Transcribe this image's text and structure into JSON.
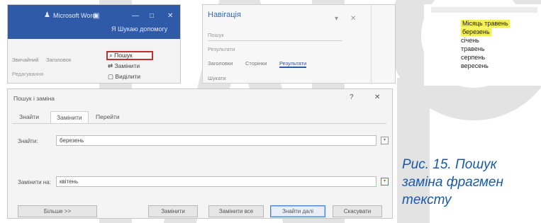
{
  "ribbon": {
    "title": "Microsoft Word",
    "search_label": "Я Шукаю допомогу",
    "find": "Пошук",
    "replace": "Замінити",
    "select": "Виділити",
    "styles_left": "Звичайний",
    "styles_mid": "Заголовок",
    "paragraph": "Редагування"
  },
  "navigation": {
    "title": "Навігація",
    "search_placeholder": "Пошук",
    "results": "Результати",
    "tabs": [
      "Заголовки",
      "Сторінки",
      "Результати"
    ],
    "footer": "Шукати"
  },
  "highlight": {
    "words": [
      "Місяць травень",
      "березень",
      "січень",
      "травень",
      "серпень",
      "вересень"
    ],
    "highlighted": [
      true,
      true,
      false,
      false,
      false,
      false
    ]
  },
  "dialog": {
    "title": "Пошук і заміна",
    "tabs": [
      "Знайти",
      "Замінити",
      "Перейти"
    ],
    "find_label": "Знайти:",
    "find_value": "березень",
    "replace_label": "Замінити на:",
    "replace_value": "квітень",
    "buttons": {
      "more": "Більше >>",
      "replace": "Замінити",
      "replace_all": "Замінити все",
      "find_next": "Знайти далі",
      "cancel": "Скасувати"
    }
  },
  "caption": {
    "line1": "Рис. 15. Пошук",
    "line2": "заміна фрагмен",
    "line3": "тексту"
  }
}
